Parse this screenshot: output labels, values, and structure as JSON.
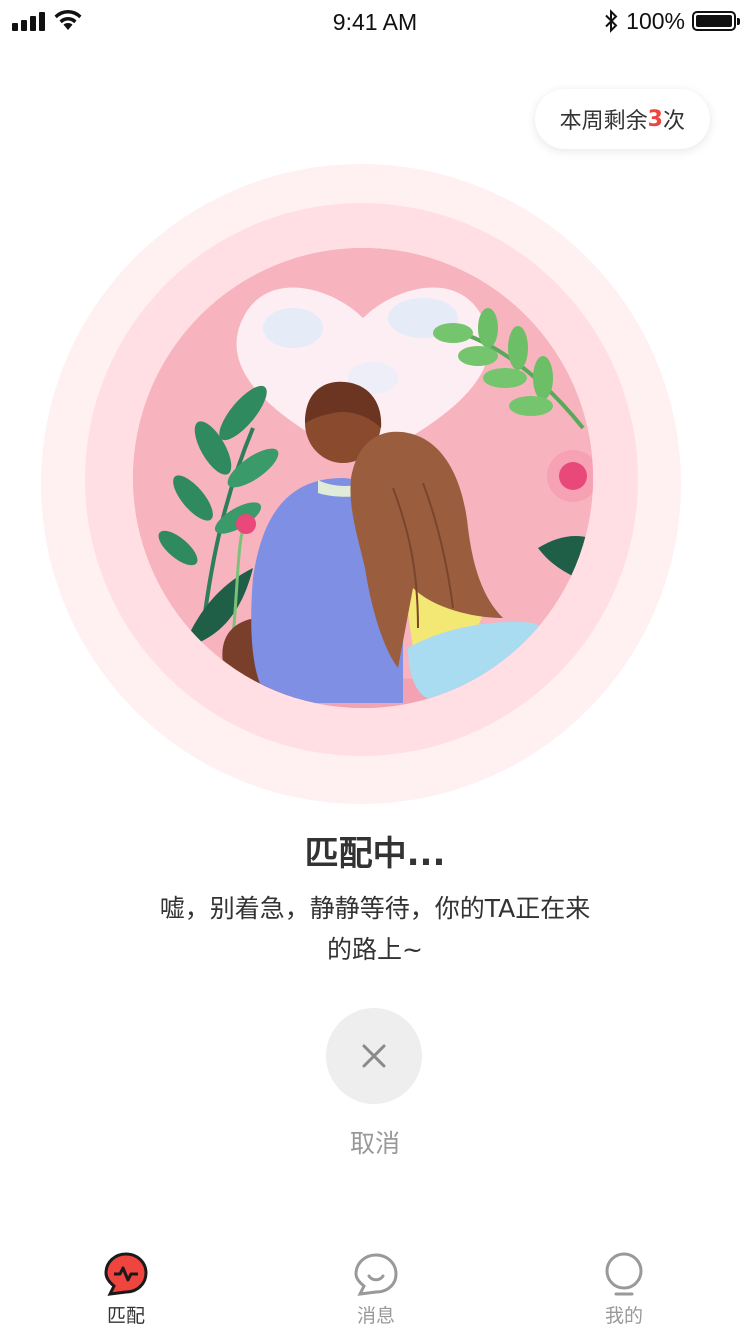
{
  "status_bar": {
    "time": "9:41 AM",
    "battery": "100%",
    "icons": [
      "signal-icon",
      "wifi-icon",
      "bluetooth-icon",
      "battery-icon"
    ]
  },
  "remaining": {
    "prefix": "本周剩余",
    "count": "3",
    "suffix": "次",
    "count_color": "#f0443f"
  },
  "illustration": {
    "alt": "couple-sitting-illustration"
  },
  "match": {
    "title": "匹配中...",
    "description": "嘘，别着急，静静等待，你的TA正在来的路上~"
  },
  "cancel": {
    "icon": "close-icon",
    "label": "取消"
  },
  "tabs": [
    {
      "label": "匹配",
      "icon": "match-icon",
      "active": true,
      "accent": "#f0443f"
    },
    {
      "label": "消息",
      "icon": "message-icon",
      "active": false
    },
    {
      "label": "我的",
      "icon": "profile-icon",
      "active": false
    }
  ],
  "colors": {
    "accent": "#f0443f",
    "ring_outer": "#fff0f2",
    "ring_mid": "#ffdfe4",
    "ring_inner": "#f8b8c2"
  }
}
